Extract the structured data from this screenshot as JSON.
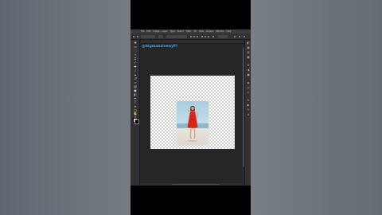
{
  "app": {
    "menus": [
      "File",
      "Edit",
      "Image",
      "Layer",
      "Type",
      "Select",
      "Filter",
      "3D",
      "View",
      "Plugins",
      "Window",
      "Help"
    ]
  },
  "document": {
    "tab_title": "",
    "status": ""
  },
  "watermark": {
    "text": "@bigmassivenyFl"
  },
  "colors": {
    "accent": "#3fa0e6",
    "dress": "#d9261c",
    "ui_dark": "#262626",
    "ui_panel": "#303030"
  },
  "icons": {
    "tools": [
      "move-icon",
      "marquee-icon",
      "lasso-icon",
      "magic-wand-icon",
      "crop-icon",
      "eyedropper-icon",
      "healing-brush-icon",
      "brush-icon",
      "clone-stamp-icon",
      "history-brush-icon",
      "eraser-icon",
      "gradient-icon",
      "blur-icon",
      "dodge-icon",
      "pen-icon",
      "type-icon",
      "path-selection-icon",
      "rectangle-icon",
      "hand-icon",
      "zoom-icon"
    ],
    "panels": [
      "color-panel-icon",
      "swatches-icon",
      "gradients-icon",
      "patterns-icon",
      "properties-icon",
      "adjustments-icon",
      "libraries-icon",
      "layers-icon",
      "channels-icon",
      "paths-icon",
      "history-icon",
      "actions-icon",
      "brushes-icon",
      "character-icon"
    ]
  }
}
